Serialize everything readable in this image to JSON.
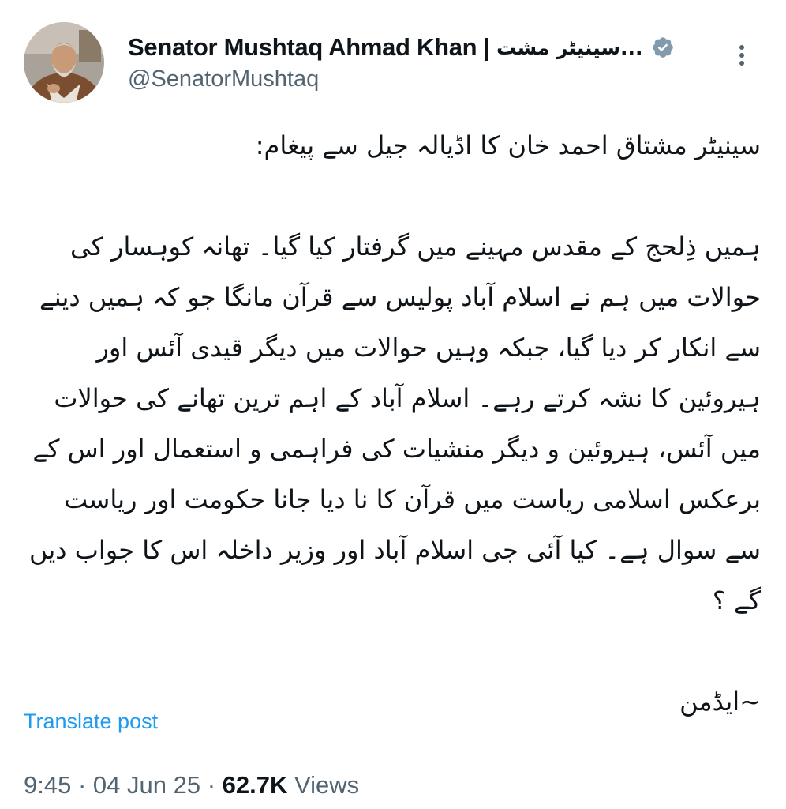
{
  "author": {
    "display_name": "Senator Mushtaq Ahmad Khan |",
    "display_name_urdu": "...سینیٹر مشت",
    "handle": "@SenatorMushtaq",
    "verified_icon": "verified-badge-icon",
    "more_icon": "more-options-icon"
  },
  "tweet": {
    "heading": "سینیٹر مشتاق احمد خان کا اڈیالہ جیل سے پیغام:",
    "body": "ہمیں ذِلحج کے مقدس مہینے میں گرفتار کیا گیا۔ تھانہ کوہسار کی حوالات میں ہم نے اسلام آباد پولیس سے قرآن مانگا جو کہ ہمیں دینے سے انکار کر دیا گیا، جبکہ وہیں حوالات میں دیگر قیدی آئس اور ہیروئین کا نشہ کرتے رہے۔ اسلام آباد کے اہم ترین تھانے کی حوالات میں آئس، ہیروئین و دیگر منشیات کی فراہمی و استعمال اور اس کے برعکس اسلامی ریاست میں قرآن کا نا دیا جانا حکومت اور ریاست سے سوال ہے۔ کیا آئی جی اسلام آباد اور وزیر داخلہ اس کا جواب دیں گے ؟",
    "signature": "~ایڈمن"
  },
  "translate_label": "Translate post",
  "meta": {
    "time": "9:45",
    "separator": "·",
    "date": "04 Jun 25",
    "views_count": "62.7K",
    "views_label": "Views"
  },
  "colors": {
    "text": "#0f1419",
    "secondary": "#536471",
    "link": "#1d9bf0",
    "verified": "#829aab"
  }
}
